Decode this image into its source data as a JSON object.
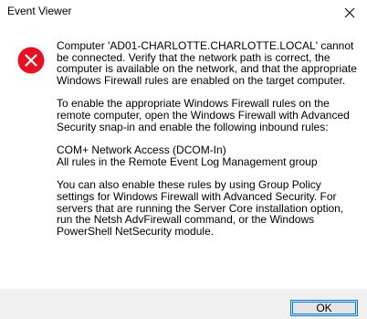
{
  "window": {
    "title": "Event Viewer"
  },
  "icons": {
    "error": "error-icon",
    "close": "close-icon"
  },
  "colors": {
    "error_red": "#e81123",
    "accent": "#0078d7",
    "footer_bg": "#f0f0f0"
  },
  "message": {
    "paragraphs": [
      "Computer 'AD01-CHARLOTTE.CHARLOTTE.LOCAL' cannot be connected. Verify that the network path is correct, the computer is available on the network, and that the appropriate Windows Firewall rules are enabled on the target computer.",
      "To enable the appropriate Windows Firewall rules on the remote computer, open the Windows Firewall with Advanced Security snap-in and enable the following inbound rules:",
      "COM+ Network Access (DCOM-In)\nAll rules in the Remote Event Log Management group",
      "You can also enable these rules by using Group Policy settings for Windows Firewall with Advanced Security. For servers that are running the Server Core installation option, run the Netsh AdvFirewall command, or the Windows PowerShell NetSecurity module."
    ]
  },
  "buttons": {
    "ok_label": "OK"
  }
}
